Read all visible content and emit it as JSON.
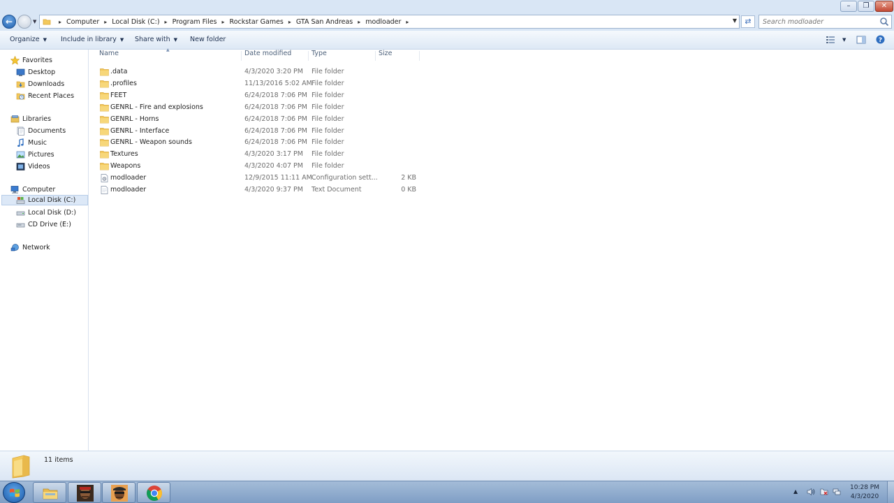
{
  "window": {
    "minimize_glyph": "–",
    "maximize_glyph": "❐",
    "close_glyph": "✕"
  },
  "address": {
    "breadcrumbs": [
      "Computer",
      "Local Disk (C:)",
      "Program Files",
      "Rockstar Games",
      "GTA San Andreas",
      "modloader"
    ],
    "search_placeholder": "Search modloader"
  },
  "toolbar": {
    "organize": "Organize",
    "include_in_library": "Include in library",
    "share_with": "Share with",
    "new_folder": "New folder"
  },
  "sidebar": {
    "favorites": {
      "label": "Favorites",
      "items": [
        "Desktop",
        "Downloads",
        "Recent Places"
      ]
    },
    "libraries": {
      "label": "Libraries",
      "items": [
        "Documents",
        "Music",
        "Pictures",
        "Videos"
      ]
    },
    "computer": {
      "label": "Computer",
      "items": [
        "Local Disk (C:)",
        "Local Disk (D:)",
        "CD Drive (E:)"
      ],
      "selected": "Local Disk (C:)"
    },
    "network": {
      "label": "Network"
    }
  },
  "columns": {
    "name": "Name",
    "date_modified": "Date modified",
    "type": "Type",
    "size": "Size"
  },
  "files": [
    {
      "name": ".data",
      "date": "4/3/2020 3:20 PM",
      "type": "File folder",
      "size": "",
      "icon": "folder-icon"
    },
    {
      "name": ".profiles",
      "date": "11/13/2016 5:02 AM",
      "type": "File folder",
      "size": "",
      "icon": "folder-icon"
    },
    {
      "name": "FEET",
      "date": "6/24/2018 7:06 PM",
      "type": "File folder",
      "size": "",
      "icon": "folder-icon"
    },
    {
      "name": "GENRL - Fire and explosions",
      "date": "6/24/2018 7:06 PM",
      "type": "File folder",
      "size": "",
      "icon": "folder-icon"
    },
    {
      "name": "GENRL - Horns",
      "date": "6/24/2018 7:06 PM",
      "type": "File folder",
      "size": "",
      "icon": "folder-icon"
    },
    {
      "name": "GENRL - Interface",
      "date": "6/24/2018 7:06 PM",
      "type": "File folder",
      "size": "",
      "icon": "folder-icon"
    },
    {
      "name": "GENRL - Weapon sounds",
      "date": "6/24/2018 7:06 PM",
      "type": "File folder",
      "size": "",
      "icon": "folder-icon"
    },
    {
      "name": "Textures",
      "date": "4/3/2020 3:17 PM",
      "type": "File folder",
      "size": "",
      "icon": "folder-icon"
    },
    {
      "name": "Weapons",
      "date": "4/3/2020 4:07 PM",
      "type": "File folder",
      "size": "",
      "icon": "folder-icon"
    },
    {
      "name": "modloader",
      "date": "12/9/2015 11:11 AM",
      "type": "Configuration sett...",
      "size": "2 KB",
      "icon": "config-file-icon"
    },
    {
      "name": "modloader",
      "date": "4/3/2020 9:37 PM",
      "type": "Text Document",
      "size": "0 KB",
      "icon": "text-file-icon"
    }
  ],
  "status": {
    "item_count": "11 items"
  },
  "taskbar": {
    "apps": [
      "explorer-icon",
      "gta-sa-icon",
      "gta-sa-icon",
      "chrome-icon"
    ],
    "time": "10:28 PM",
    "date": "4/3/2020"
  },
  "colors": {
    "folder": "#f3c95c",
    "folder_dark": "#d9a63a",
    "chrome_header": "#d9e6f5",
    "selection": "#dce8f7"
  }
}
